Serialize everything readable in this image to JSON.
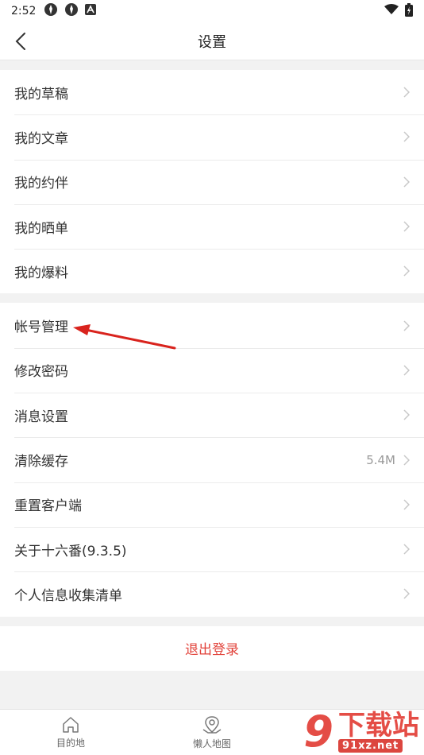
{
  "status_bar": {
    "time": "2:52"
  },
  "header": {
    "title": "设置"
  },
  "groups": [
    {
      "items": [
        {
          "label": "我的草稿"
        },
        {
          "label": "我的文章"
        },
        {
          "label": "我的约伴"
        },
        {
          "label": "我的晒单"
        },
        {
          "label": "我的爆料"
        }
      ]
    },
    {
      "items": [
        {
          "label": "帐号管理"
        },
        {
          "label": "修改密码"
        },
        {
          "label": "消息设置"
        },
        {
          "label": "清除缓存",
          "value": "5.4M"
        },
        {
          "label": "重置客户端"
        },
        {
          "label": "关于十六番(9.3.5)"
        },
        {
          "label": "个人信息收集清单"
        }
      ]
    }
  ],
  "logout": {
    "label": "退出登录"
  },
  "tabbar": {
    "tabs": [
      {
        "label": "目的地"
      },
      {
        "label": "懒人地图"
      }
    ]
  },
  "watermark": {
    "text": "下载站",
    "site": "91xz.net",
    "mark": "9"
  },
  "colors": {
    "accent": "#e2433b",
    "annotation_arrow": "#d9231d"
  }
}
